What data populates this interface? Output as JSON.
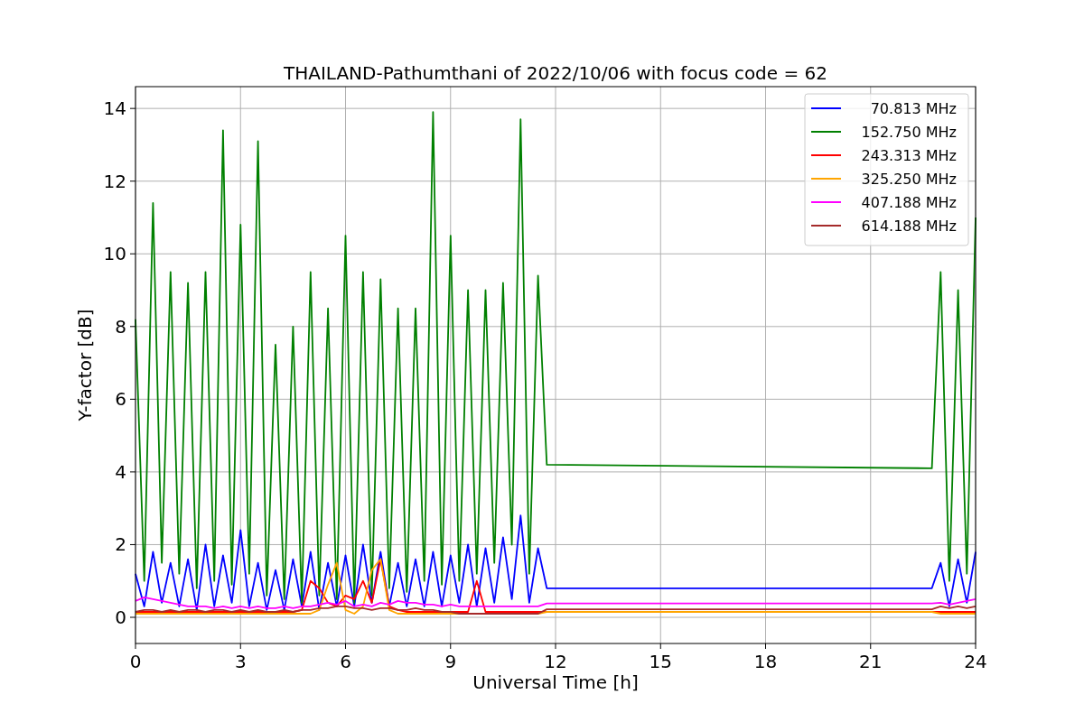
{
  "chart_data": {
    "type": "line",
    "title": "THAILAND-Pathumthani of 2022/10/06 with focus code = 62",
    "xlabel": "Universal Time [h]",
    "ylabel": "Y-factor [dB]",
    "x": [
      0,
      0.25,
      0.5,
      0.75,
      1,
      1.25,
      1.5,
      1.75,
      2,
      2.25,
      2.5,
      2.75,
      3,
      3.25,
      3.5,
      3.75,
      4,
      4.25,
      4.5,
      4.75,
      5,
      5.25,
      5.5,
      5.75,
      6,
      6.25,
      6.5,
      6.75,
      7,
      7.25,
      7.5,
      7.75,
      8,
      8.25,
      8.5,
      8.75,
      9,
      9.25,
      9.5,
      9.75,
      10,
      10.25,
      10.5,
      10.75,
      11,
      11.25,
      11.5,
      11.75,
      22.75,
      23,
      23.25,
      23.5,
      23.75,
      24
    ],
    "series": [
      {
        "name": "70.813 MHz",
        "color": "#0000ff",
        "values": [
          1.2,
          0.3,
          1.8,
          0.4,
          1.5,
          0.3,
          1.6,
          0.2,
          2.0,
          0.3,
          1.7,
          0.4,
          2.4,
          0.3,
          1.5,
          0.2,
          1.3,
          0.2,
          1.6,
          0.3,
          1.8,
          0.2,
          1.5,
          0.3,
          1.7,
          0.3,
          2.0,
          0.4,
          1.8,
          0.3,
          1.5,
          0.3,
          1.6,
          0.3,
          1.8,
          0.3,
          1.7,
          0.4,
          2.0,
          0.3,
          1.9,
          0.4,
          2.2,
          0.5,
          2.8,
          0.4,
          1.9,
          0.8,
          0.8,
          1.5,
          0.3,
          1.6,
          0.4,
          1.8
        ]
      },
      {
        "name": "152.750 MHz",
        "color": "#008000",
        "values": [
          8.2,
          1.0,
          11.4,
          1.5,
          9.5,
          1.2,
          9.2,
          0.8,
          9.5,
          1.0,
          13.4,
          0.9,
          10.8,
          1.2,
          13.1,
          0.6,
          7.5,
          0.5,
          8.0,
          0.4,
          9.5,
          0.6,
          8.5,
          0.5,
          10.5,
          0.4,
          9.5,
          0.6,
          9.3,
          0.8,
          8.5,
          0.7,
          8.5,
          1.0,
          13.9,
          0.9,
          10.5,
          1.0,
          9.0,
          1.2,
          9.0,
          1.5,
          9.2,
          2.0,
          13.7,
          1.2,
          9.4,
          4.2,
          4.1,
          9.5,
          1.0,
          9.0,
          1.2,
          11.0
        ]
      },
      {
        "name": "243.313 MHz",
        "color": "#ff0000",
        "values": [
          0.15,
          0.15,
          0.15,
          0.15,
          0.15,
          0.15,
          0.15,
          0.15,
          0.15,
          0.15,
          0.15,
          0.15,
          0.15,
          0.15,
          0.15,
          0.15,
          0.15,
          0.15,
          0.15,
          0.2,
          1.0,
          0.8,
          0.4,
          0.3,
          0.6,
          0.5,
          1.0,
          0.4,
          1.6,
          0.3,
          0.2,
          0.15,
          0.15,
          0.15,
          0.15,
          0.15,
          0.15,
          0.15,
          0.15,
          1.0,
          0.15,
          0.15,
          0.15,
          0.15,
          0.15,
          0.15,
          0.15,
          0.15,
          0.15,
          0.15,
          0.15,
          0.15,
          0.15,
          0.15
        ]
      },
      {
        "name": "325.250 MHz",
        "color": "#ffa500",
        "values": [
          0.1,
          0.1,
          0.1,
          0.1,
          0.1,
          0.1,
          0.1,
          0.1,
          0.1,
          0.1,
          0.1,
          0.1,
          0.1,
          0.1,
          0.1,
          0.1,
          0.1,
          0.1,
          0.1,
          0.1,
          0.1,
          0.2,
          0.9,
          1.5,
          0.2,
          0.1,
          0.3,
          1.3,
          1.6,
          0.2,
          0.1,
          0.1,
          0.1,
          0.1,
          0.1,
          0.1,
          0.1,
          0.1,
          0.1,
          0.1,
          0.1,
          0.1,
          0.1,
          0.1,
          0.1,
          0.1,
          0.1,
          0.15,
          0.15,
          0.1,
          0.1,
          0.1,
          0.1,
          0.1
        ]
      },
      {
        "name": "407.188 MHz",
        "color": "#ff00ff",
        "values": [
          0.45,
          0.55,
          0.5,
          0.45,
          0.4,
          0.35,
          0.3,
          0.3,
          0.3,
          0.25,
          0.3,
          0.25,
          0.3,
          0.25,
          0.3,
          0.25,
          0.25,
          0.3,
          0.25,
          0.3,
          0.3,
          0.35,
          0.4,
          0.35,
          0.45,
          0.3,
          0.35,
          0.3,
          0.4,
          0.35,
          0.45,
          0.4,
          0.4,
          0.35,
          0.35,
          0.3,
          0.35,
          0.3,
          0.3,
          0.3,
          0.3,
          0.3,
          0.3,
          0.3,
          0.3,
          0.3,
          0.3,
          0.38,
          0.38,
          0.4,
          0.35,
          0.4,
          0.45,
          0.5
        ]
      },
      {
        "name": "614.188 MHz",
        "color": "#a52a2a",
        "values": [
          0.15,
          0.2,
          0.2,
          0.15,
          0.2,
          0.15,
          0.2,
          0.2,
          0.15,
          0.2,
          0.2,
          0.15,
          0.2,
          0.15,
          0.2,
          0.15,
          0.15,
          0.2,
          0.15,
          0.2,
          0.2,
          0.25,
          0.25,
          0.3,
          0.3,
          0.25,
          0.25,
          0.2,
          0.25,
          0.25,
          0.2,
          0.2,
          0.25,
          0.2,
          0.2,
          0.15,
          0.15,
          0.1,
          0.1,
          0.1,
          0.1,
          0.1,
          0.1,
          0.1,
          0.1,
          0.1,
          0.1,
          0.22,
          0.22,
          0.3,
          0.25,
          0.3,
          0.25,
          0.3
        ]
      }
    ],
    "xlim": [
      0,
      24
    ],
    "ylim": [
      -0.72,
      14.6
    ],
    "xticks": [
      0,
      3,
      6,
      9,
      12,
      15,
      18,
      21,
      24
    ],
    "yticks": [
      0,
      2,
      4,
      6,
      8,
      10,
      12,
      14
    ],
    "grid": true,
    "legend": true
  }
}
